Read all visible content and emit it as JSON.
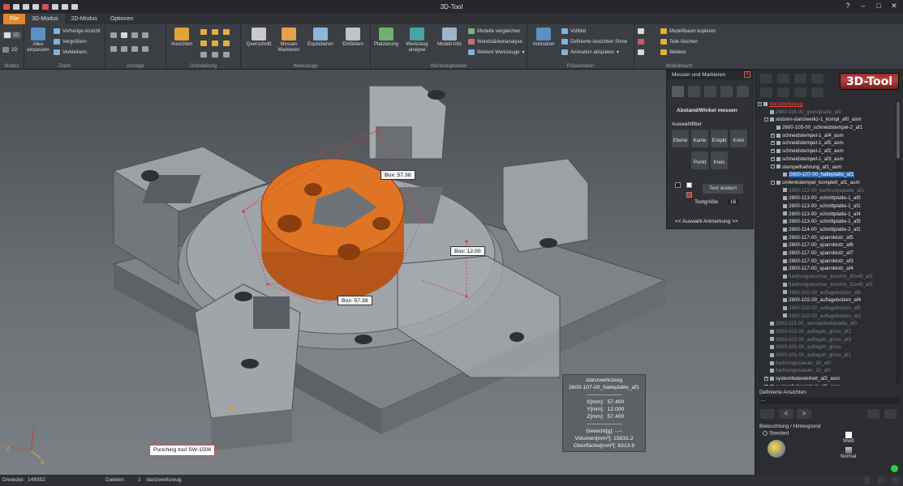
{
  "app": {
    "title": "3D-Tool",
    "logo": "3D-Tool"
  },
  "tabs": [
    {
      "label": "File"
    },
    {
      "label": "3D-Modus"
    },
    {
      "label": "2D-Modus"
    },
    {
      "label": "Optionen"
    }
  ],
  "ribbon": {
    "modus": {
      "label": "Modus",
      "btn3d": "3D",
      "btn2d": "2D"
    },
    "zoom": {
      "label": "Zoom",
      "fit": "Alles einpassen",
      "prev": "Vorherige Ansicht",
      "enlarge": "Vergrößern",
      "shrink": "Verkleinern"
    },
    "anzeige": {
      "label": "Anzeige"
    },
    "orientierung": {
      "label": "Orientierung",
      "views": "Ansichten"
    },
    "werkzeuge": {
      "label": "Werkzeuge",
      "section": "Querschnitt",
      "measure": "Messen Markieren",
      "explode": "Explodieren",
      "color": "Einfärben"
    },
    "werkzeugkasten": {
      "label": "Werkzeugkasten",
      "placement": "Platzierung",
      "analysis": "Werkzeug analyse",
      "info": "Modell-Info",
      "compare": "Modelle vergleichen",
      "wall": "Wandstärkenanalyse",
      "more": "Weitere Werkzeuge"
    },
    "praesentation": {
      "label": "Präsentation",
      "animation": "Animation",
      "full": "Vollbild",
      "defviews": "Definierte Ansichten Show",
      "play": "Animation abspielen"
    },
    "modellbaum": {
      "label": "Modellbaum",
      "copy": "Modellbaum kopieren",
      "delete": "Teile löschen",
      "more": "Weitere"
    }
  },
  "measure_panel": {
    "title": "Messen und Markieren",
    "mode": "Abstand/Winkel messen",
    "filter_title": "Auswahlfilter",
    "filters": [
      "Ebene",
      "Kante",
      "Eckpkt",
      "Kreis",
      "Punkt",
      "Kreis"
    ],
    "text_change": "Text ändern",
    "text_size_label": "Textgröße",
    "text_size": "16",
    "nav": "<<  Auswahl Anmerkung  >>"
  },
  "tree": [
    {
      "label": "stanzwerkzeug",
      "indent": 0,
      "box": "-",
      "kind": "root"
    },
    {
      "label": "2600-116-00_grundplatte_af0",
      "indent": 1,
      "dim": true
    },
    {
      "label": "stutzen-stanzwerkz-1_kompl_af0_asm",
      "indent": 1,
      "box": "-"
    },
    {
      "label": "2600-105-00_schneidstempel-2_af1",
      "indent": 2
    },
    {
      "label": "schneidstempel-1_af4_asm",
      "indent": 2,
      "box": "+"
    },
    {
      "label": "schneidstempel-1_af5_asm",
      "indent": 2,
      "box": "+"
    },
    {
      "label": "schneidstempel-1_af2_asm",
      "indent": 2,
      "box": "+"
    },
    {
      "label": "schneidstempel-1_af3_asm",
      "indent": 2,
      "box": "+"
    },
    {
      "label": "stempelfuehrung_af1_asm",
      "indent": 2,
      "box": "-"
    },
    {
      "label": "2600-107-00_halteplatte_af1",
      "indent": 3,
      "sel": true
    },
    {
      "label": "umlenkstempel_komplett_af1_asm",
      "indent": 2,
      "box": "-"
    },
    {
      "label": "2600-112-00_fuehrungsplatte_af1",
      "indent": 3,
      "dim": true
    },
    {
      "label": "2600-113-00_schnittplatte-1_af0",
      "indent": 3
    },
    {
      "label": "2600-113-00_schnittplatte-1_af1",
      "indent": 3
    },
    {
      "label": "2600-113-00_schnittplatte-1_af4",
      "indent": 3
    },
    {
      "label": "2600-113-00_schnittplatte-1_af5",
      "indent": 3
    },
    {
      "label": "2600-114-00_schnittplatte-2_af1",
      "indent": 3
    },
    {
      "label": "2600-117-00_spannklotz_af5",
      "indent": 3
    },
    {
      "label": "2600-117-00_spannklotz_af6",
      "indent": 3
    },
    {
      "label": "2600-117-00_spannklotz_af7",
      "indent": 3
    },
    {
      "label": "2600-117-00_spannklotz_af3",
      "indent": 3
    },
    {
      "label": "2600-117-00_spannklotz_af4",
      "indent": 3
    },
    {
      "label": "fuehrungsbuchse_durchm_30x45_af1",
      "indent": 3,
      "dim": true
    },
    {
      "label": "fuehrungsbuchse_durchm_32x45_af1",
      "indent": 3,
      "dim": true
    },
    {
      "label": "2600-102-00_auflagebolzen_af6",
      "indent": 3,
      "dim": true
    },
    {
      "label": "2600-102-00_auflagebolzen_af4",
      "indent": 3
    },
    {
      "label": "2600-102-00_auflagebolzen_af5",
      "indent": 3,
      "dim": true
    },
    {
      "label": "2600-102-00_auflagebolzen_af1",
      "indent": 3,
      "dim": true
    },
    {
      "label": "2600-115-00_stempelhalteplatte_af0",
      "indent": 1,
      "dim": true
    },
    {
      "label": "2600-101-00_auflageb_gross_af2",
      "indent": 1,
      "dim": true
    },
    {
      "label": "2600-101-00_auflageb_gross_af3",
      "indent": 1,
      "dim": true
    },
    {
      "label": "2600-101-00_auflageb_gross",
      "indent": 1,
      "dim": true
    },
    {
      "label": "2600-101-00_auflageb_gross_af1",
      "indent": 1,
      "dim": true
    },
    {
      "label": "fuehrungssaeule_30_af0",
      "indent": 1,
      "dim": true
    },
    {
      "label": "fuehrungssaeule_32_af0",
      "indent": 1,
      "dim": true
    },
    {
      "label": "systemfedereinheit_af2_asm",
      "indent": 1,
      "box": "+"
    },
    {
      "label": "systemfedereinheit_af6_asm",
      "indent": 1,
      "box": "+"
    }
  ],
  "right_bottom": {
    "defined_views": "Definierte Ansichten",
    "views_value": "...",
    "lighting": "Beleuchtung / Hintergrund",
    "standard": "Standard",
    "white": "Weiß",
    "normal": "Normal"
  },
  "viewport": {
    "labels": [
      {
        "text": "Box:  57.38"
      },
      {
        "text": "Box:  12.00"
      },
      {
        "text": "Box:  57.38"
      }
    ],
    "info": {
      "name": "stanzwerkzeug",
      "part": "2600-107-00_halteplatte_af1",
      "dash": "----------------------------------",
      "x_label": "X[mm]:",
      "x_val": "57.400",
      "y_label": "Y[mm]:",
      "y_val": "12.000",
      "z_label": "Z[mm]:",
      "z_val": "57.400",
      "weight": "Gewicht[g]: -.--",
      "volume": "Volumen[mm³]: 15831.2",
      "surface": "Oberfläche[mm²]:  8313.9"
    },
    "annotation": "Punching tool SW-1508",
    "axes": {
      "x": "X",
      "z": "Z"
    }
  },
  "status": {
    "triangles_label": "Dreiecke:",
    "triangles": "149352",
    "files_label": "Dateien:",
    "files_count": "1",
    "file": "stanzwerkzeug"
  },
  "colors": {
    "accent": "#e0882a",
    "selection": "#2f6fc1",
    "part_orange": "#d9691c",
    "part_gray": "#8f9498"
  }
}
